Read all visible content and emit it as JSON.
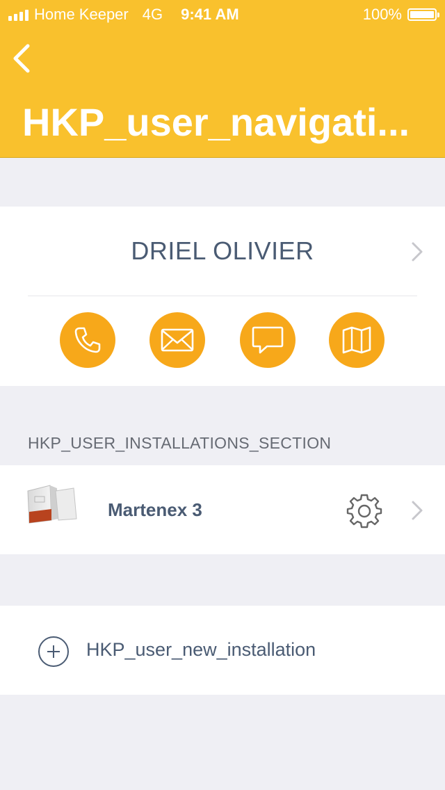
{
  "status_bar": {
    "carrier": "Home Keeper",
    "network": "4G",
    "time": "9:41 AM",
    "battery": "100%"
  },
  "header": {
    "title": "HKP_user_navigati...",
    "back_icon": "chevron-left-icon",
    "background_color": "#f9c12d"
  },
  "contact": {
    "name": "DRIEL OLIVIER",
    "actions": [
      {
        "icon": "phone-icon"
      },
      {
        "icon": "mail-icon"
      },
      {
        "icon": "message-icon"
      },
      {
        "icon": "map-icon"
      }
    ],
    "action_color": "#f7a81a"
  },
  "installations": {
    "section_label": "HKP_USER_INSTALLATIONS_SECTION",
    "items": [
      {
        "name": "Martenex 3",
        "settings_icon": "gear-icon"
      }
    ]
  },
  "new_installation": {
    "label": "HKP_user_new_installation",
    "icon": "plus-circle-icon"
  }
}
